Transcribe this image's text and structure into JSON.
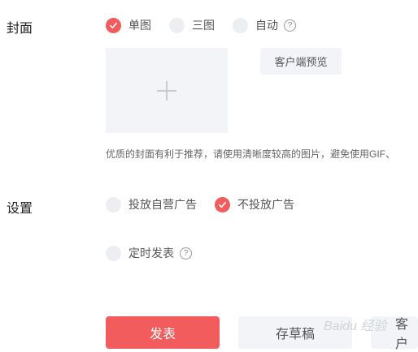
{
  "cover": {
    "label": "封面",
    "options": [
      {
        "label": "单图",
        "checked": true
      },
      {
        "label": "三图",
        "checked": false
      },
      {
        "label": "自动",
        "checked": false
      }
    ],
    "help": "?",
    "preview_button": "客户端预览",
    "hint": "优质的封面有利于推荐，请使用清晰度较高的图片，避免使用GIF、"
  },
  "settings": {
    "label": "设置",
    "options": [
      {
        "label": "投放自营广告",
        "checked": false
      },
      {
        "label": "不投放广告",
        "checked": true
      }
    ],
    "schedule_label": "定时发表",
    "help": "?"
  },
  "actions": {
    "publish": "发表",
    "save_draft": "存草稿",
    "client_partial": "客户"
  },
  "watermark": "Baidu 经验",
  "colors": {
    "accent": "#f35c5c",
    "muted_bg": "#f3f4f7"
  }
}
